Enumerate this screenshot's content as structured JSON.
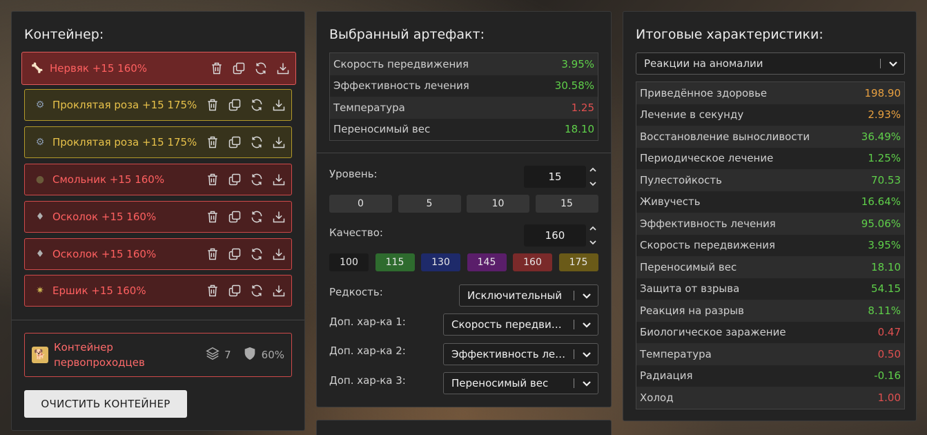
{
  "left": {
    "title": "Контейнер:",
    "items": [
      {
        "name": "Нервяк +15 160%",
        "style": "red",
        "icon": "worm-icon"
      },
      {
        "name": "Проклятая роза +15 175%",
        "style": "gold",
        "icon": "rose-icon"
      },
      {
        "name": "Проклятая роза +15 175%",
        "style": "gold",
        "icon": "rose-icon"
      },
      {
        "name": "Смольник +15 160%",
        "style": "red",
        "icon": "resin-icon"
      },
      {
        "name": "Осколок +15 160%",
        "style": "red",
        "icon": "shard-icon"
      },
      {
        "name": "Осколок +15 160%",
        "style": "red",
        "icon": "shard-icon"
      },
      {
        "name": "Ершик +15 160%",
        "style": "red",
        "icon": "urchin-icon"
      }
    ],
    "container": {
      "name_line1": "Контейнер",
      "name_line2": "первопроходцев",
      "slots": "7",
      "protection": "60%"
    },
    "clear_button": "ОЧИСТИТЬ КОНТЕЙНЕР"
  },
  "middle": {
    "title": "Выбранный артефакт:",
    "stats": [
      {
        "label": "Скорость передвижения",
        "value": "3.95%",
        "color": "green"
      },
      {
        "label": "Эффективность лечения",
        "value": "30.58%",
        "color": "green"
      },
      {
        "label": "Температура",
        "value": "1.25",
        "color": "red"
      },
      {
        "label": "Переносимый вес",
        "value": "18.10",
        "color": "green"
      }
    ],
    "level_label": "Уровень:",
    "level_value": "15",
    "level_presets": [
      "0",
      "5",
      "10",
      "15"
    ],
    "quality_label": "Качество:",
    "quality_value": "160",
    "quality_presets": [
      {
        "label": "100",
        "color": "#1a1a1a"
      },
      {
        "label": "115",
        "color": "#2e6b2e"
      },
      {
        "label": "130",
        "color": "#1e2a6a"
      },
      {
        "label": "145",
        "color": "#5a1e6a"
      },
      {
        "label": "160",
        "color": "#7a2a2a"
      },
      {
        "label": "175",
        "color": "#6a5a18"
      }
    ],
    "rarity_label": "Редкость:",
    "rarity_value": "Исключительный",
    "extra1_label": "Доп. хар-ка 1:",
    "extra1_value": "Скорость передвижения",
    "extra2_label": "Доп. хар-ка 2:",
    "extra2_value": "Эффективность лечения",
    "extra3_label": "Доп. хар-ка 3:",
    "extra3_value": "Переносимый вес"
  },
  "right": {
    "title": "Итоговые характеристики:",
    "filter_value": "Реакции на аномалии",
    "stats": [
      {
        "label": "Приведённое здоровье",
        "value": "198.90",
        "color": "orange"
      },
      {
        "label": "Лечение в секунду",
        "value": "2.93%",
        "color": "orange"
      },
      {
        "label": "Восстановление выносливости",
        "value": "36.49%",
        "color": "green"
      },
      {
        "label": "Периодическое лечение",
        "value": "1.25%",
        "color": "green"
      },
      {
        "label": "Пулестойкость",
        "value": "70.53",
        "color": "green"
      },
      {
        "label": "Живучесть",
        "value": "16.64%",
        "color": "green"
      },
      {
        "label": "Эффективность лечения",
        "value": "95.06%",
        "color": "green"
      },
      {
        "label": "Скорость передвижения",
        "value": "3.95%",
        "color": "green"
      },
      {
        "label": "Переносимый вес",
        "value": "18.10",
        "color": "green"
      },
      {
        "label": "Защита от взрыва",
        "value": "54.15",
        "color": "green"
      },
      {
        "label": "Реакция на разрыв",
        "value": "8.11%",
        "color": "green"
      },
      {
        "label": "Биологическое заражение",
        "value": "0.47",
        "color": "red"
      },
      {
        "label": "Температура",
        "value": "0.50",
        "color": "red"
      },
      {
        "label": "Радиация",
        "value": "-0.16",
        "color": "green"
      },
      {
        "label": "Холод",
        "value": "1.00",
        "color": "red"
      }
    ]
  }
}
